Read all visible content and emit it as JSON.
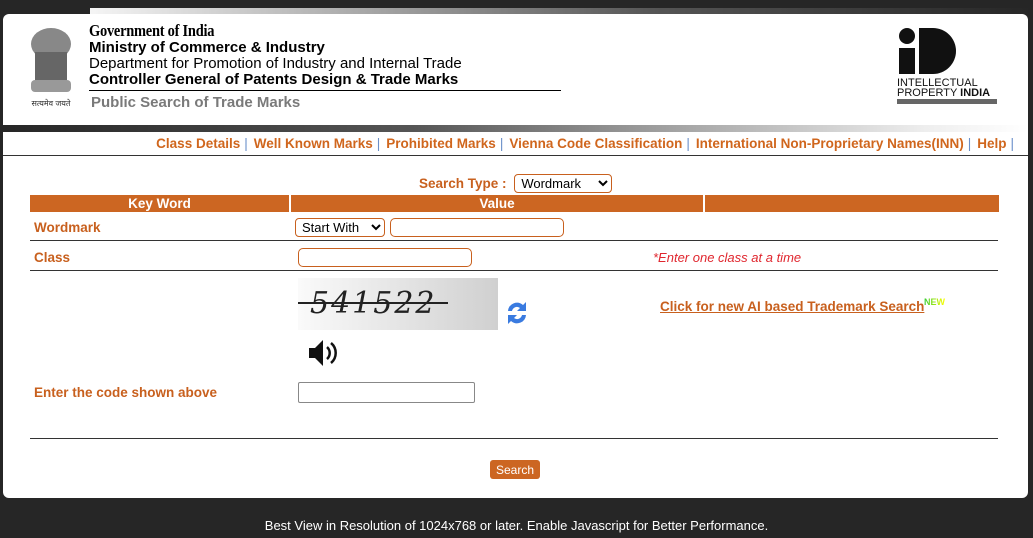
{
  "header": {
    "gov": "Government of India",
    "ministry": "Ministry of Commerce & Industry",
    "department": "Department for Promotion of Industry and Internal Trade",
    "controller": "Controller General of Patents Design & Trade Marks",
    "subtitle": "Public Search of Trade Marks",
    "emblem_motto": "सत्यमेव जयते",
    "logo_text": "INTELLECTUAL PROPERTY INDIA"
  },
  "nav": [
    "Class Details",
    "Well Known Marks",
    "Prohibited Marks",
    "Vienna Code Classification",
    "International Non-Proprietary Names(INN)",
    "Help"
  ],
  "nav_sep": "|",
  "search_type": {
    "label": "Search Type :",
    "value": "Wordmark"
  },
  "table": {
    "headers": [
      "Key Word",
      "Value",
      ""
    ]
  },
  "wordmark": {
    "label": "Wordmark",
    "match": "Start With",
    "value": ""
  },
  "class": {
    "label": "Class",
    "value": "",
    "hint": "*Enter one class at a time"
  },
  "captcha": {
    "text": "541522",
    "code_label": "Enter the code shown above",
    "code_value": ""
  },
  "ai_link": "Click for new AI based Trademark Search",
  "new_badge": "NEW",
  "search_button": "Search",
  "footer": "Best View in Resolution of 1024x768 or later. Enable Javascript for Better Performance.",
  "colors": {
    "accent": "#cc6622",
    "hint": "#e0262e",
    "background": "#262626"
  }
}
